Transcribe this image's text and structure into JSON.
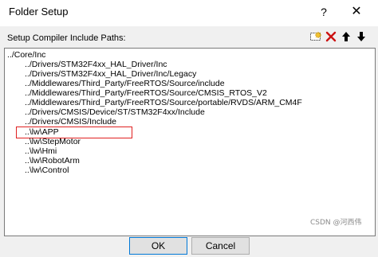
{
  "window": {
    "title": "Folder Setup",
    "help_glyph": "?",
    "close_glyph": "✕"
  },
  "group": {
    "label": "Setup Compiler Include Paths:"
  },
  "toolbar": {
    "icons": [
      "new-folder-icon",
      "delete-icon",
      "move-up-icon",
      "move-down-icon"
    ],
    "delete_color": "#cc1111"
  },
  "paths": [
    "../Core/Inc",
    "../Drivers/STM32F4xx_HAL_Driver/Inc",
    "../Drivers/STM32F4xx_HAL_Driver/Inc/Legacy",
    "../Middlewares/Third_Party/FreeRTOS/Source/include",
    "../Middlewares/Third_Party/FreeRTOS/Source/CMSIS_RTOS_V2",
    "../Middlewares/Third_Party/FreeRTOS/Source/portable/RVDS/ARM_CM4F",
    "../Drivers/CMSIS/Device/ST/STM32F4xx/Include",
    "../Drivers/CMSIS/Include",
    "..\\lw\\APP",
    "..\\lw\\StepMotor",
    "..\\lw\\Hmi",
    "..\\lw\\RobotArm",
    "..\\lw\\Control"
  ],
  "highlighted_path": "..\\lw\\APP",
  "buttons": {
    "ok": "OK",
    "cancel": "Cancel"
  },
  "watermark": "CSDN @河西伟"
}
